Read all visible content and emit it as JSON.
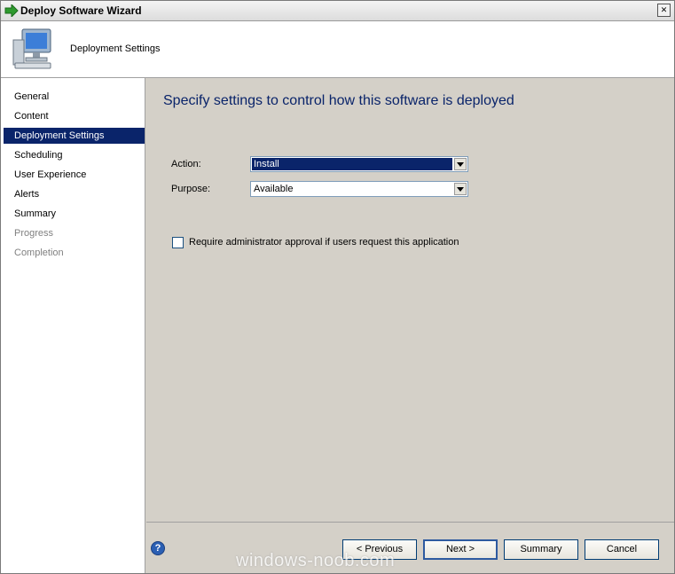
{
  "window": {
    "title": "Deploy Software Wizard",
    "close_glyph": "✕"
  },
  "header": {
    "title": "Deployment Settings",
    "icon": "computer-icon"
  },
  "nav": {
    "items": [
      {
        "label": "General",
        "state": "normal"
      },
      {
        "label": "Content",
        "state": "normal"
      },
      {
        "label": "Deployment Settings",
        "state": "active"
      },
      {
        "label": "Scheduling",
        "state": "normal"
      },
      {
        "label": "User Experience",
        "state": "normal"
      },
      {
        "label": "Alerts",
        "state": "normal"
      },
      {
        "label": "Summary",
        "state": "normal"
      },
      {
        "label": "Progress",
        "state": "disabled"
      },
      {
        "label": "Completion",
        "state": "disabled"
      }
    ]
  },
  "main": {
    "heading": "Specify settings to control how this software is deployed",
    "action": {
      "label": "Action:",
      "value": "Install"
    },
    "purpose": {
      "label": "Purpose:",
      "value": "Available"
    },
    "approval_checkbox": {
      "label": "Require administrator approval if users request this application",
      "checked": false
    }
  },
  "footer": {
    "help_glyph": "?",
    "previous_label": "< Previous",
    "next_label": "Next >",
    "summary_label": "Summary",
    "cancel_label": "Cancel"
  },
  "watermark": "windows-noob.com",
  "colors": {
    "accent": "#0a246a",
    "heading": "#0a246a",
    "disabled_text": "#808080",
    "panel_bg": "#d4d0c8"
  }
}
